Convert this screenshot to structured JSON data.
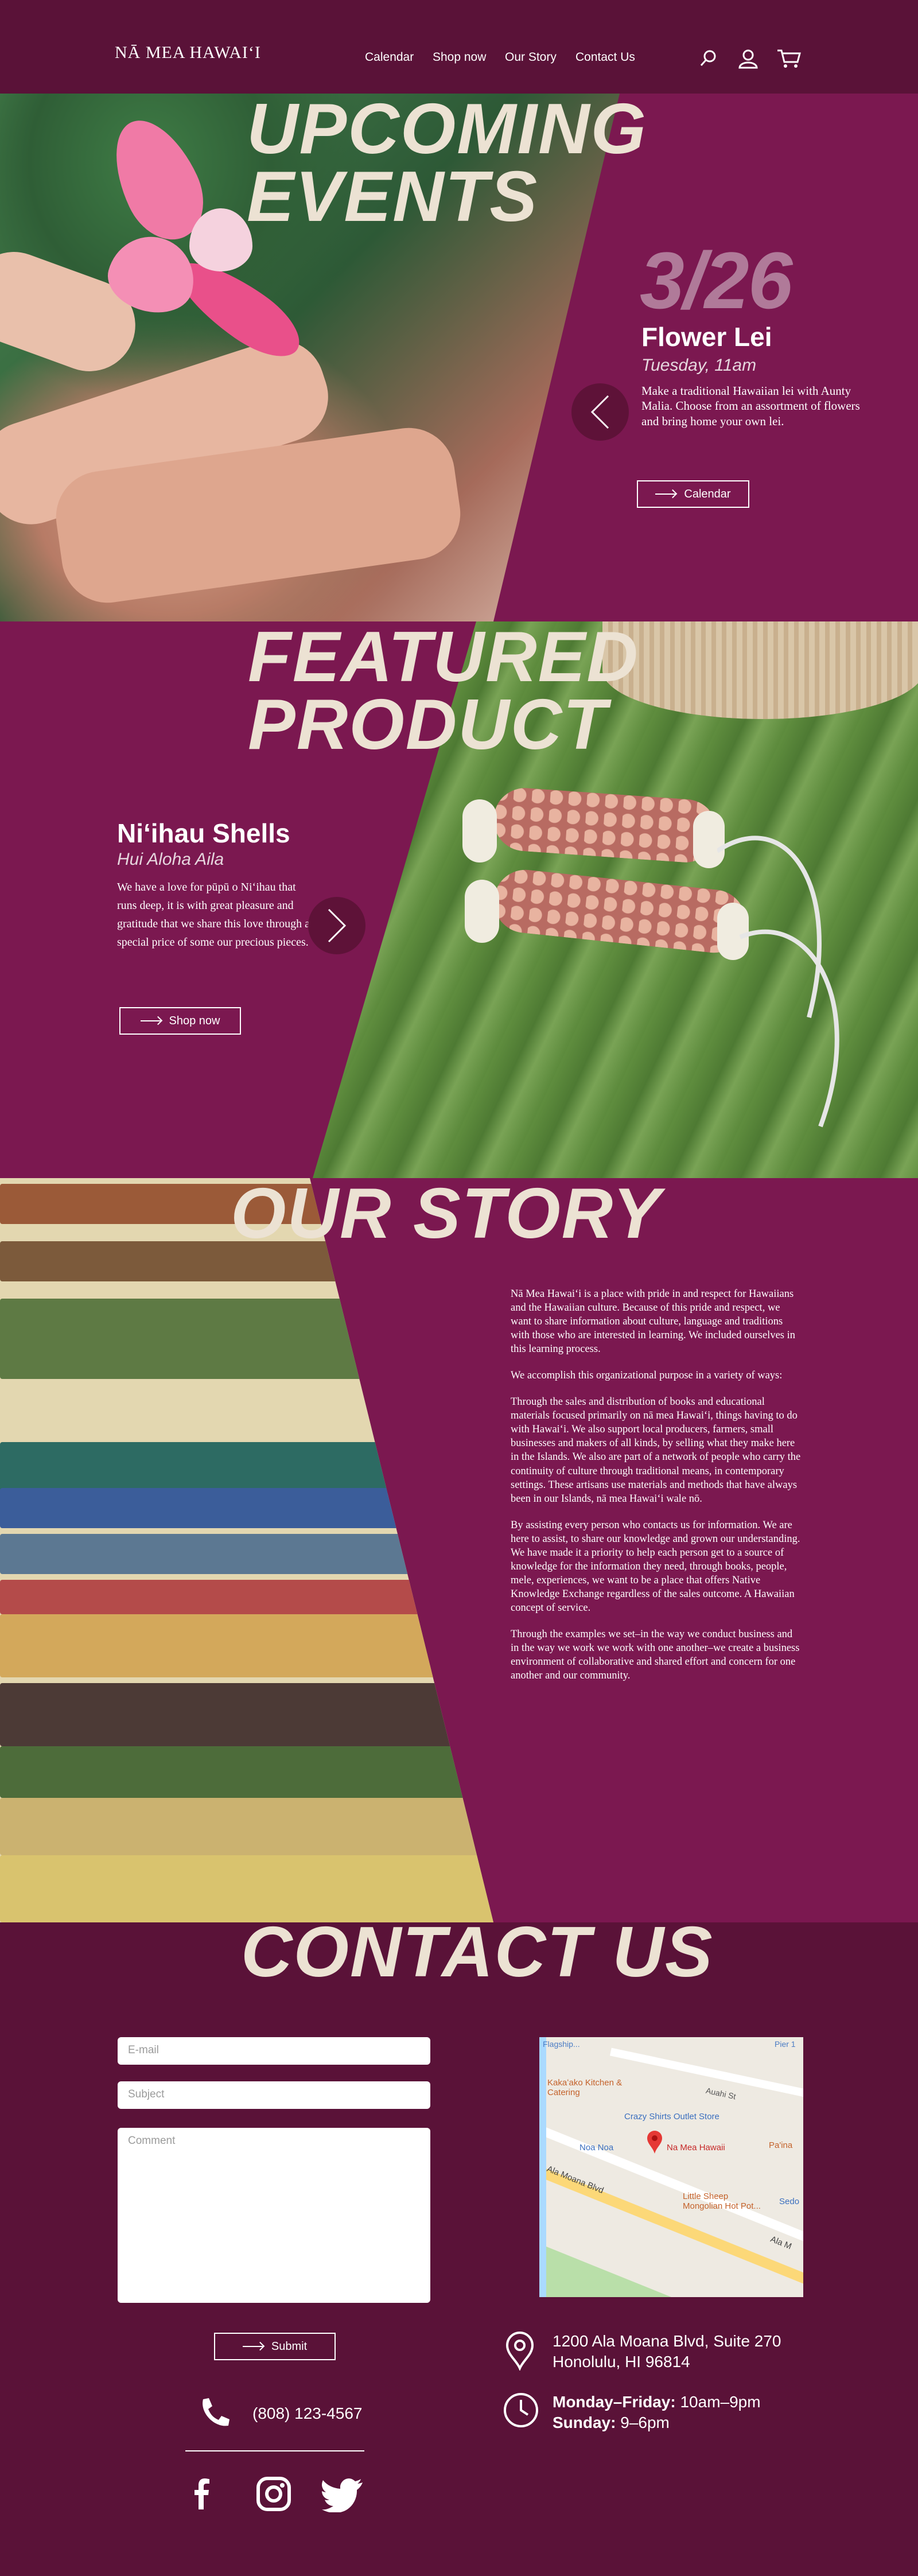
{
  "header": {
    "logo": "NĀ MEA HAWAIʻI",
    "nav": [
      "Calendar",
      "Shop now",
      "Our Story",
      "Contact Us"
    ],
    "icons": [
      "search-icon",
      "user-icon",
      "cart-icon"
    ]
  },
  "events": {
    "title_line1": "UPCOMING",
    "title_line2": "EVENTS",
    "date": "3/26",
    "event_title": "Flower Lei",
    "event_time": "Tuesday, 11am",
    "description": "Make a traditional Hawaiian lei with Aunty Malia. Choose from an assortment of flowers and bring home your own lei.",
    "button": "Calendar"
  },
  "featured": {
    "title_line1": "FEATURED",
    "title_line2": "PRODUCT",
    "product_name": "Niʻihau Shells",
    "product_subtitle": "Hui Aloha Aila",
    "description": "We have a love for pūpū o Niʻihau that runs deep, it is with great pleasure and gratitude that we share this love through a special price of some our precious pieces.",
    "button": "Shop now"
  },
  "story": {
    "title": "OUR STORY",
    "paragraphs": [
      "Nā Mea Hawaiʻi is a place with pride in and respect for Hawaiians and the Hawaiian culture. Because of this pride and respect, we want to share information about culture, language and traditions with those who are interested in learning. We included ourselves in this learning process.",
      "We accomplish this organizational purpose in a variety of ways:",
      "Through the sales and distribution of books and educational materials focused primarily on nā mea Hawaiʻi, things having to do with Hawaiʻi. We also support local producers, farmers, small businesses and makers of all kinds, by selling what they make here in the Islands. We also are part of a network of people who carry the continuity of culture through traditional means, in contemporary settings. These artisans use materials and methods that have always been in our Islands, nā mea Hawaiʻi wale nō.",
      "By assisting every person who contacts us for information. We are here to assist, to share our knowledge and grown our understanding. We have made it a priority to help each person get to a source of knowledge for the information they need, through books, people, mele, experiences, we want to be a place that offers Native Knowledge Exchange regardless of the sales outcome. A Hawaiian concept of service.",
      "Through the examples we set–in the way we conduct business and in the way we work we work with one another–we create a business environment of collaborative and shared effort and concern for one another and our community."
    ]
  },
  "contact": {
    "title": "CONTACT US",
    "email_placeholder": "E-mail",
    "subject_placeholder": "Subject",
    "comment_placeholder": "Comment",
    "submit": "Submit",
    "phone": "(808) 123-4567",
    "address_line1": "1200 Ala Moana Blvd, Suite 270",
    "address_line2": "Honolulu, HI 96814",
    "hours_line1_label": "Monday–Friday:",
    "hours_line1_value": "10am–9pm",
    "hours_line2_label": "Sunday:",
    "hours_line2_value": "9–6pm",
    "social": [
      "facebook-icon",
      "instagram-icon",
      "twitter-icon"
    ],
    "map": {
      "labels": [
        "Flagship...",
        "Pier 1",
        "Kakaʻako Kitchen & Catering",
        "Auahi St",
        "Crazy Shirts Outlet Store",
        "Noa Noa",
        "Na Mea Hawaii",
        "Pa'ina",
        "Ala Moana Blvd",
        "Little Sheep Mongolian Hot Pot...",
        "Sedo",
        "Ala M"
      ]
    }
  },
  "colors": {
    "header_bg": "#5a1238",
    "section_bg": "#7b1850",
    "title_cream": "#ece2d3",
    "date_pink": "#b07a99"
  }
}
